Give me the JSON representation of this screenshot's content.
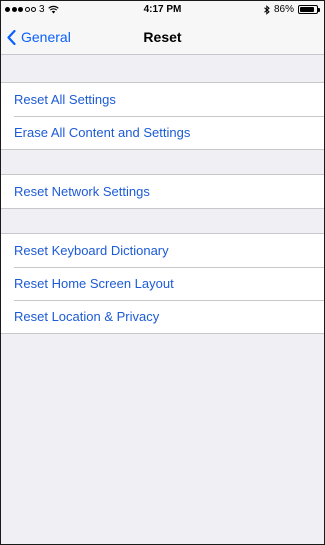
{
  "status_bar": {
    "carrier": "3",
    "time": "4:17 PM",
    "battery_text": "86%",
    "battery_level": 0.86
  },
  "nav": {
    "back_label": "General",
    "title": "Reset"
  },
  "groups": [
    {
      "items": [
        "Reset All Settings",
        "Erase All Content and Settings"
      ]
    },
    {
      "items": [
        "Reset Network Settings"
      ]
    },
    {
      "items": [
        "Reset Keyboard Dictionary",
        "Reset Home Screen Layout",
        "Reset Location & Privacy"
      ]
    }
  ],
  "colors": {
    "link": "#1c5bd6",
    "background": "#efeff4",
    "separator": "#c8c7cc"
  }
}
